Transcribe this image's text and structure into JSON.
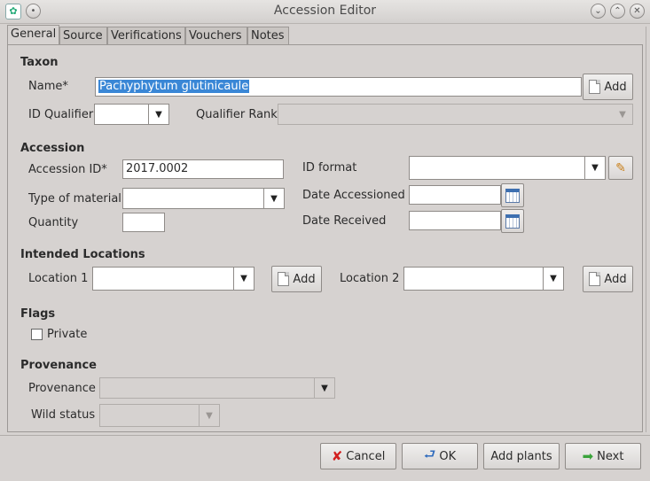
{
  "window": {
    "title": "Accession Editor"
  },
  "tabs": [
    "General",
    "Source",
    "Verifications",
    "Vouchers",
    "Notes"
  ],
  "taxon": {
    "section": "Taxon",
    "name_label": "Name*",
    "name_value": "Pachyphytum glutinicaule",
    "add_label": "Add",
    "id_qualifier_label": "ID Qualifier",
    "qualifier_rank_label": "Qualifier Rank"
  },
  "accession": {
    "section": "Accession",
    "id_label": "Accession ID*",
    "id_value": "2017.0002",
    "id_format_label": "ID format",
    "type_label": "Type of material",
    "date_accessioned_label": "Date Accessioned",
    "quantity_label": "Quantity",
    "date_received_label": "Date Received"
  },
  "locations": {
    "section": "Intended Locations",
    "loc1_label": "Location 1",
    "loc2_label": "Location 2",
    "add_label": "Add"
  },
  "flags": {
    "section": "Flags",
    "private_label": "Private",
    "private_checked": false
  },
  "provenance": {
    "section": "Provenance",
    "provenance_label": "Provenance",
    "wild_status_label": "Wild status"
  },
  "footer": {
    "cancel": "Cancel",
    "ok": "OK",
    "add_plants": "Add plants",
    "next": "Next"
  }
}
